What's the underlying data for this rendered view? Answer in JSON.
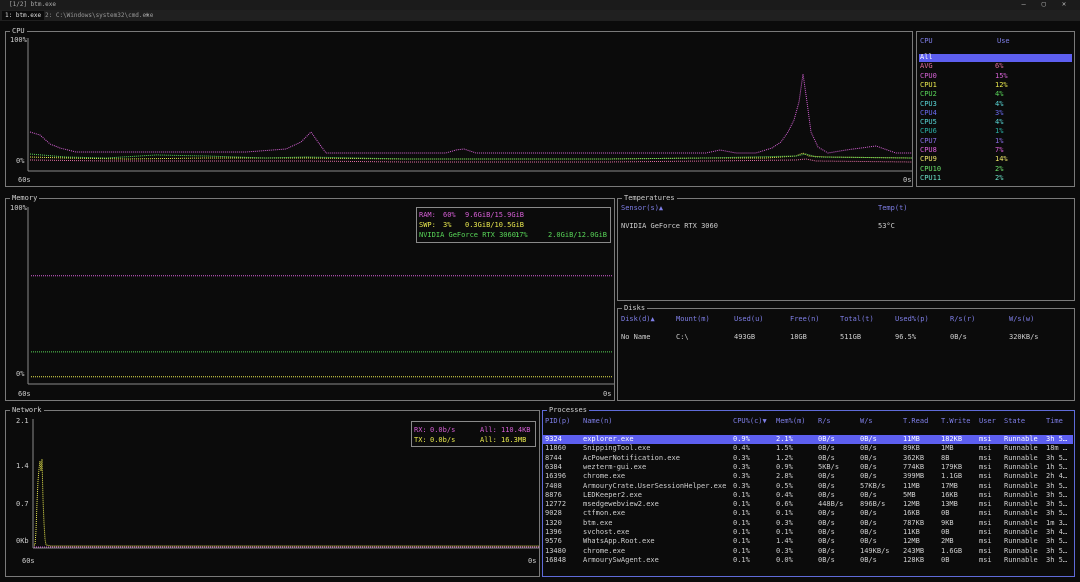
{
  "window": {
    "title": "[1/2] btm.exe",
    "controls": [
      "—",
      "▢",
      "✕"
    ]
  },
  "tabs": [
    {
      "label": "1: btm.exe",
      "active": true
    },
    {
      "label": "2: C:\\Windows\\system32\\cmd.exe",
      "active": false
    }
  ],
  "new_tab_label": "+",
  "cpu": {
    "title": "CPU",
    "y_top": "100%",
    "y_bottom": "0%",
    "x_left": "60s",
    "x_right": "0s",
    "list_headers": {
      "name": "CPU",
      "use": "Use"
    },
    "list": [
      {
        "name": "All",
        "use": "",
        "color": "#2a2a2a",
        "selected": true
      },
      {
        "name": "AVG",
        "use": "6%",
        "color": "#e06c9f"
      },
      {
        "name": "CPU0",
        "use": "15%",
        "color": "#d662d6"
      },
      {
        "name": "CPU1",
        "use": "12%",
        "color": "#e8e84e"
      },
      {
        "name": "CPU2",
        "use": "4%",
        "color": "#58d658"
      },
      {
        "name": "CPU3",
        "use": "4%",
        "color": "#58d6d6"
      },
      {
        "name": "CPU4",
        "use": "3%",
        "color": "#6a6af0"
      },
      {
        "name": "CPU5",
        "use": "4%",
        "color": "#58d6d6"
      },
      {
        "name": "CPU6",
        "use": "1%",
        "color": "#2bb3a8"
      },
      {
        "name": "CPU7",
        "use": "1%",
        "color": "#8a6ee8"
      },
      {
        "name": "CPU8",
        "use": "7%",
        "color": "#e062e0"
      },
      {
        "name": "CPU9",
        "use": "14%",
        "color": "#f2ea6a"
      },
      {
        "name": "CPU10",
        "use": "2%",
        "color": "#6be06b"
      },
      {
        "name": "CPU11",
        "use": "2%",
        "color": "#6be0c8"
      }
    ]
  },
  "memory": {
    "title": "Memory",
    "y_top": "100%",
    "y_bottom": "0%",
    "x_left": "60s",
    "x_right": "0s",
    "legend": [
      {
        "label": "RAM:",
        "pct": "60%",
        "amount": "9.6GiB/15.9GiB",
        "color": "#d65fd6",
        "level": 0.6
      },
      {
        "label": "SWP:",
        "pct": "3%",
        "amount": "0.3GiB/10.5GiB",
        "color": "#e8e84e",
        "level": 0.03
      },
      {
        "label": "NVIDIA GeForce RTX 3060:",
        "pct": "17%",
        "amount": "2.0GiB/12.0GiB",
        "color": "#58d658",
        "level": 0.17
      }
    ]
  },
  "temperatures": {
    "title": "Temperatures",
    "headers": {
      "sensor": "Sensor(s)▲",
      "temp": "Temp(t)"
    },
    "rows": [
      {
        "sensor": "NVIDIA GeForce RTX 3060",
        "temp": "53°C"
      }
    ]
  },
  "disks": {
    "title": "Disks",
    "headers": [
      "Disk(d)▲",
      "Mount(m)",
      "Used(u)",
      "Free(n)",
      "Total(t)",
      "Used%(p)",
      "R/s(r)",
      "W/s(w)"
    ],
    "rows": [
      [
        "No Name",
        "C:\\",
        "493GB",
        "18GB",
        "511GB",
        "96.5%",
        "0B/s",
        "320KB/s"
      ]
    ]
  },
  "network": {
    "title": "Network",
    "y_ticks": [
      "2.1",
      "1.4",
      "0.7",
      "0Kb"
    ],
    "x_left": "60s",
    "x_right": "0s",
    "legend": [
      {
        "label": "RX:",
        "rate": "0.0b/s",
        "all_label": "All:",
        "all": "110.4KB",
        "color": "#d65fd6"
      },
      {
        "label": "TX:",
        "rate": "0.0b/s",
        "all_label": "All:",
        "all": "16.3MB",
        "color": "#e8e84e"
      }
    ]
  },
  "processes": {
    "title": "Processes",
    "headers": [
      "PID(p)",
      "Name(n)",
      "CPU%(c)▼",
      "Mem%(m)",
      "R/s",
      "W/s",
      "T.Read",
      "T.Write",
      "User",
      "State",
      "Time"
    ],
    "rows": [
      [
        "9324",
        "explorer.exe",
        "0.9%",
        "2.1%",
        "0B/s",
        "0B/s",
        "11MB",
        "182KB",
        "msi",
        "Runnable",
        "3h 5…"
      ],
      [
        "11860",
        "SnippingTool.exe",
        "0.4%",
        "1.5%",
        "0B/s",
        "0B/s",
        "89KB",
        "1MB",
        "msi",
        "Runnable",
        "18m …"
      ],
      [
        "8744",
        "AcPowerNotification.exe",
        "0.3%",
        "1.2%",
        "0B/s",
        "0B/s",
        "362KB",
        "8B",
        "msi",
        "Runnable",
        "3h 5…"
      ],
      [
        "6384",
        "wezterm-gui.exe",
        "0.3%",
        "0.9%",
        "5KB/s",
        "0B/s",
        "774KB",
        "179KB",
        "msi",
        "Runnable",
        "1h 5…"
      ],
      [
        "16396",
        "chrome.exe",
        "0.3%",
        "2.8%",
        "0B/s",
        "0B/s",
        "399MB",
        "1.1GB",
        "msi",
        "Runnable",
        "2h 4…"
      ],
      [
        "7408",
        "ArmouryCrate.UserSessionHelper.exe",
        "0.3%",
        "0.5%",
        "0B/s",
        "57KB/s",
        "11MB",
        "17MB",
        "msi",
        "Runnable",
        "3h 5…"
      ],
      [
        "8876",
        "LEDKeeper2.exe",
        "0.1%",
        "0.4%",
        "0B/s",
        "0B/s",
        "5MB",
        "16KB",
        "msi",
        "Runnable",
        "3h 5…"
      ],
      [
        "12772",
        "msedgewebview2.exe",
        "0.1%",
        "0.6%",
        "448B/s",
        "896B/s",
        "12MB",
        "13MB",
        "msi",
        "Runnable",
        "3h 5…"
      ],
      [
        "9028",
        "ctfmon.exe",
        "0.1%",
        "0.1%",
        "0B/s",
        "0B/s",
        "16KB",
        "0B",
        "msi",
        "Runnable",
        "3h 5…"
      ],
      [
        "1320",
        "btm.exe",
        "0.1%",
        "0.3%",
        "0B/s",
        "0B/s",
        "787KB",
        "9KB",
        "msi",
        "Runnable",
        "1m 3…"
      ],
      [
        "1396",
        "svchost.exe",
        "0.1%",
        "0.1%",
        "0B/s",
        "0B/s",
        "11KB",
        "0B",
        "msi",
        "Runnable",
        "3h 4…"
      ],
      [
        "9576",
        "WhatsApp.Root.exe",
        "0.1%",
        "1.4%",
        "0B/s",
        "0B/s",
        "12MB",
        "2MB",
        "msi",
        "Runnable",
        "3h 5…"
      ],
      [
        "13480",
        "chrome.exe",
        "0.1%",
        "0.3%",
        "0B/s",
        "149KB/s",
        "243MB",
        "1.6GB",
        "msi",
        "Runnable",
        "3h 5…"
      ],
      [
        "16848",
        "ArmourySwAgent.exe",
        "0.1%",
        "0.0%",
        "0B/s",
        "0B/s",
        "128KB",
        "0B",
        "msi",
        "Runnable",
        "3h 5…"
      ]
    ]
  },
  "colors": {
    "accent": "#5d5ff0",
    "header_text": "#7f7fe8",
    "border": "#7a7a7a",
    "background": "#0b0b0b"
  }
}
